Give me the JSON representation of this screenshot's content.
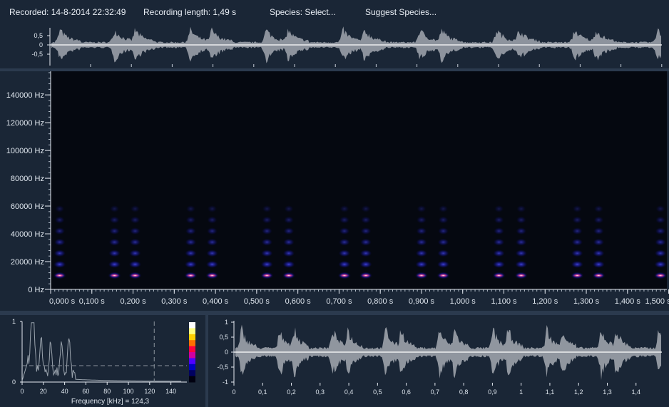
{
  "header": {
    "recorded": "Recorded: 14-8-2014 22:32:49",
    "length": "Recording length: 1,49 s",
    "species_button": "Species: Select...",
    "suggest_button": "Suggest Species..."
  },
  "waveform_top": {
    "y_ticks": [
      "0,5",
      "0",
      "-0,5"
    ]
  },
  "spectrogram": {
    "y_ticks": [
      "0 Hz",
      "20000 Hz",
      "40000 Hz",
      "60000 Hz",
      "80000 Hz",
      "100000 Hz",
      "120000 Hz",
      "140000 Hz"
    ],
    "x_ticks": [
      "0,000 s",
      "0,100 s",
      "0,200 s",
      "0,300 s",
      "0,400 s",
      "0,500 s",
      "0,600 s",
      "0,700 s",
      "0,800 s",
      "0,900 s",
      "1,000 s",
      "1,100 s",
      "1,200 s",
      "1,300 s",
      "1,400 s",
      "1,500 s"
    ],
    "pulse_times_s": [
      0.022,
      0.155,
      0.205,
      0.34,
      0.392,
      0.525,
      0.578,
      0.713,
      0.765,
      0.9,
      0.953,
      1.088,
      1.142,
      1.278,
      1.33,
      1.48
    ]
  },
  "spectrum": {
    "y_ticks": [
      "1",
      "0"
    ],
    "x_ticks": [
      "0",
      "20",
      "40",
      "60",
      "80",
      "100",
      "120",
      "140"
    ],
    "xlabel": "Frequency [kHz] = 124,3",
    "cursor_khz": 124.3,
    "threshold": 0.27,
    "colorbar": [
      "#ffffff",
      "#ffff80",
      "#ffd000",
      "#ff7000",
      "#ff0040",
      "#d000a0",
      "#5000ff",
      "#0000c0",
      "#000060",
      "#000010"
    ]
  },
  "waveform_bottom": {
    "y_ticks": [
      "1",
      "0,5",
      "0",
      "-0,5",
      "-1"
    ],
    "x_ticks": [
      "0",
      "0,1",
      "0,2",
      "0,3",
      "0,4",
      "0,5",
      "0,6",
      "0,7",
      "0,8",
      "0,9",
      "1",
      "1,1",
      "1,2",
      "1,3",
      "1,4"
    ]
  },
  "colors": {
    "background": "#1a2636",
    "plot_bg": "#050810",
    "waveform": "#9aa0a8",
    "axis": "#e6ebf2"
  }
}
